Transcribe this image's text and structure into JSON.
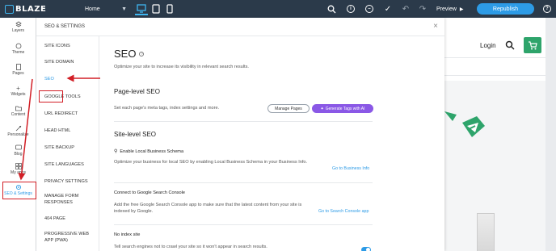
{
  "app": {
    "brand": "BLAZE",
    "page_select": "Home"
  },
  "toolbar": {
    "preview_label": "Preview",
    "republish_label": "Republish",
    "colors": {
      "bar": "#2b3a4a",
      "accent": "#2d9be6"
    },
    "icons": [
      "desktop-icon",
      "tablet-icon",
      "mobile-icon",
      "search-icon",
      "info-icon",
      "zoom-out-icon",
      "check-icon",
      "undo-icon",
      "redo-icon",
      "play-icon",
      "help-icon"
    ]
  },
  "rail": {
    "items": [
      {
        "label": "Layers",
        "icon": "layers-icon"
      },
      {
        "label": "Theme",
        "icon": "theme-icon"
      },
      {
        "label": "Pages",
        "icon": "pages-icon"
      },
      {
        "label": "Widgets",
        "icon": "plus-icon"
      },
      {
        "label": "Content",
        "icon": "folder-icon"
      },
      {
        "label": "Personalize",
        "icon": "personalize-icon"
      },
      {
        "label": "Blog",
        "icon": "blog-icon"
      },
      {
        "label": "My apps",
        "icon": "apps-icon"
      },
      {
        "label": "SEO & Settings",
        "icon": "gear-icon"
      }
    ]
  },
  "panel": {
    "title": "SEO & SETTINGS",
    "nav": [
      "SITE ICONS",
      "SITE DOMAIN",
      "SEO",
      "GOOGLE TOOLS",
      "URL REDIRECT",
      "HEAD HTML",
      "SITE BACKUP",
      "SITE LANGUAGES",
      "PRIVACY SETTINGS",
      "MANAGE FORM RESPONSES",
      "404 PAGE",
      "PROGRESSIVE WEB APP (PWA)"
    ],
    "active_nav": "SEO"
  },
  "seo": {
    "title": "SEO",
    "description": "Optimize your site to increase its visibility in relevant search results.",
    "page_level": {
      "title": "Page-level SEO",
      "description": "Set each page's meta tags, index settings and more.",
      "manage_pages_label": "Manage Pages",
      "generate_ai_label": "Generate Tags with AI"
    },
    "site_level": {
      "title": "Site-level SEO",
      "items": [
        {
          "title": "Enable Local Business Schema",
          "description": "Optimize your business for local SEO by enabling Local Business Schema in your Business Info.",
          "link": "Go to Business Info"
        },
        {
          "title": "Connect to Google Search Console",
          "description": "Add the free Google Search Console app to make sure that the latest content from your site is indexed by Google.",
          "link": "Go to Search Console app"
        },
        {
          "title": "No index site",
          "description": "Tell search engines not to crawl your site so it won't appear in search results.",
          "toggle_on": true
        }
      ]
    }
  },
  "site_preview": {
    "login_label": "Login",
    "cart_color": "#2ea46b"
  }
}
